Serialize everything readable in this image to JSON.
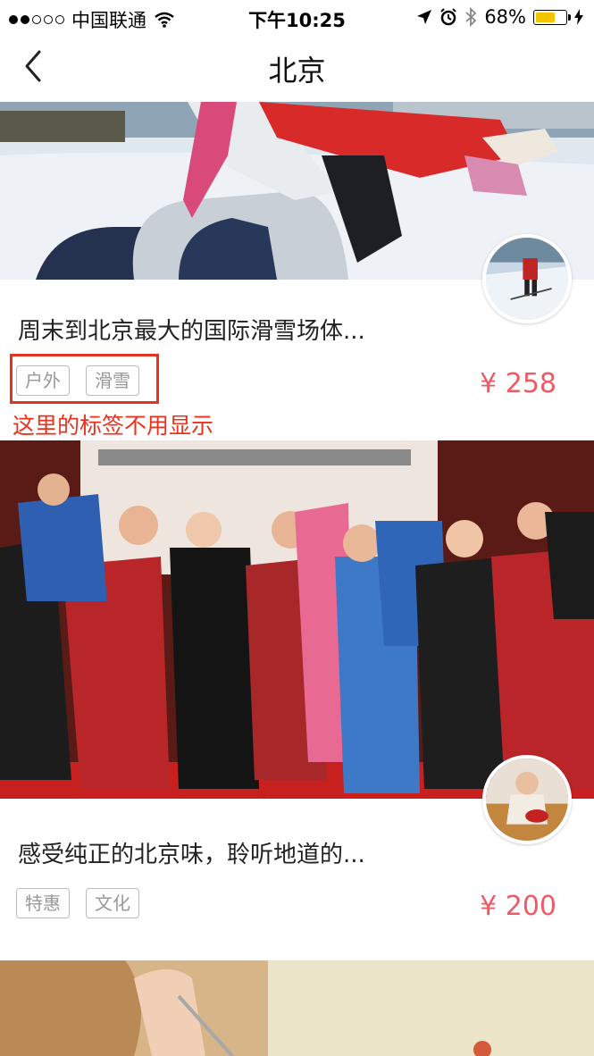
{
  "status_bar": {
    "carrier": "中国联通",
    "time": "下午10:25",
    "battery": "68%",
    "battery_level": 0.68
  },
  "nav": {
    "title": "北京"
  },
  "cards": [
    {
      "title": "周末到北京最大的国际滑雪场体...",
      "tags": [
        "户外",
        "滑雪"
      ],
      "price": "¥ 258"
    },
    {
      "title": "感受纯正的北京味，聆听地道的...",
      "tags": [
        "特惠",
        "文化"
      ],
      "price": "¥ 200"
    }
  ],
  "annotation": {
    "text": "这里的标签不用显示",
    "color": "#e8321e"
  },
  "colors": {
    "price": "#ee5a65",
    "battery": "#f5c400"
  }
}
